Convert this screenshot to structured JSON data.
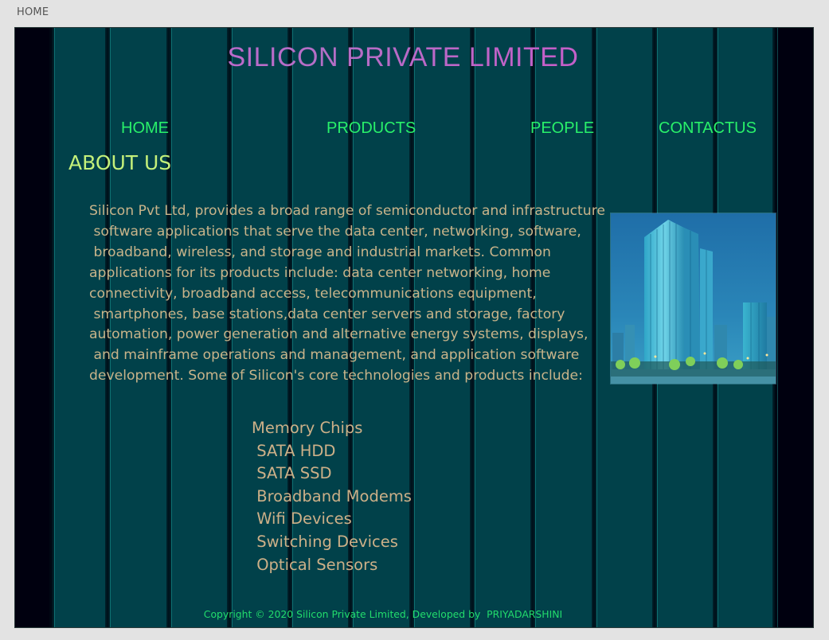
{
  "topbar": {
    "label": "HOME"
  },
  "header": {
    "title": "SILICON PRIVATE LIMITED"
  },
  "nav": {
    "home": "HOME",
    "products": "PRODUCTS",
    "people": "PEOPLE",
    "contact": "CONTACTUS"
  },
  "about": {
    "heading": "ABOUT US",
    "lines": [
      "Silicon Pvt Ltd, provides a broad range of semiconductor and infrastructure",
      " software applications that serve the data center, networking, software,",
      " broadband, wireless, and storage and industrial markets. Common",
      "applications for its products include: data center networking, home",
      "connectivity, broadband access, telecommunications equipment,",
      " smartphones, base stations,data center servers and storage, factory",
      "automation, power generation and alternative energy systems, displays,",
      " and mainframe operations and management, and application software",
      "development. Some of Silicon's core technologies and products include:"
    ]
  },
  "products": {
    "items": [
      "Memory Chips",
      " SATA HDD",
      " SATA SSD",
      " Broadband Modems",
      " Wifi Devices",
      " Switching Devices",
      " Optical Sensors"
    ]
  },
  "footer": {
    "text": "Copyright © 2020 Silicon Private Limited, Developed by  PRIYADARSHINI"
  },
  "colors": {
    "page_bg": "#e3e3e3",
    "frame_bg": "#00000f",
    "panel_bg": "#01414a",
    "nav": "#29f06a",
    "heading": "#c4f07a",
    "body_text": "#c9b48a",
    "footer": "#22dc6c",
    "title_gradient": [
      "#d05fd6",
      "#a870d5"
    ]
  }
}
